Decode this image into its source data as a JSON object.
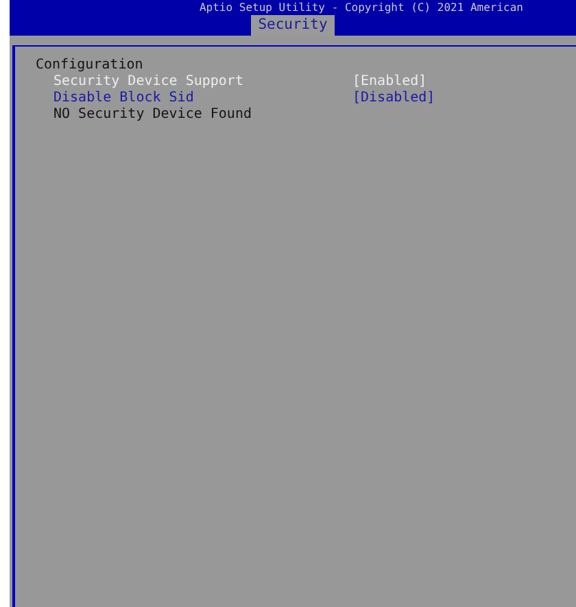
{
  "header": {
    "title": "Aptio Setup Utility - Copyright (C) 2021 American"
  },
  "tabs": [
    {
      "label": "Security",
      "selected": true
    }
  ],
  "section": {
    "title": "Configuration"
  },
  "items": [
    {
      "kind": "setting",
      "label": "Security Device Support",
      "value": "[Enabled]",
      "selected": false
    },
    {
      "kind": "setting",
      "label": "Disable Block Sid",
      "value": "[Disabled]",
      "selected": true
    },
    {
      "kind": "info",
      "label": "NO Security Device Found"
    }
  ]
}
